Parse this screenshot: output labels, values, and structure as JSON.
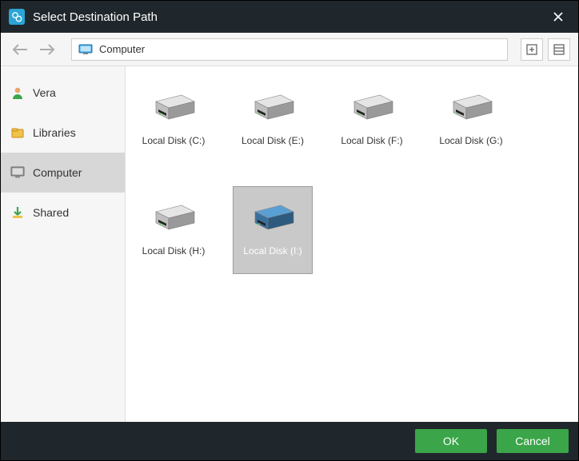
{
  "title": "Select Destination Path",
  "path_label": "Computer",
  "sidebar": {
    "items": [
      {
        "label": "Vera",
        "icon": "user",
        "selected": false
      },
      {
        "label": "Libraries",
        "icon": "libraries",
        "selected": false
      },
      {
        "label": "Computer",
        "icon": "computer",
        "selected": true
      },
      {
        "label": "Shared",
        "icon": "shared",
        "selected": false
      }
    ]
  },
  "disks": [
    {
      "label": "Local Disk (C:)",
      "selected": false,
      "color": "gray"
    },
    {
      "label": "Local Disk (E:)",
      "selected": false,
      "color": "gray"
    },
    {
      "label": "Local Disk (F:)",
      "selected": false,
      "color": "gray"
    },
    {
      "label": "Local Disk (G:)",
      "selected": false,
      "color": "gray"
    },
    {
      "label": "Local Disk (H:)",
      "selected": false,
      "color": "gray"
    },
    {
      "label": "Local Disk (I:)",
      "selected": true,
      "color": "blue"
    }
  ],
  "buttons": {
    "ok": "OK",
    "cancel": "Cancel"
  }
}
